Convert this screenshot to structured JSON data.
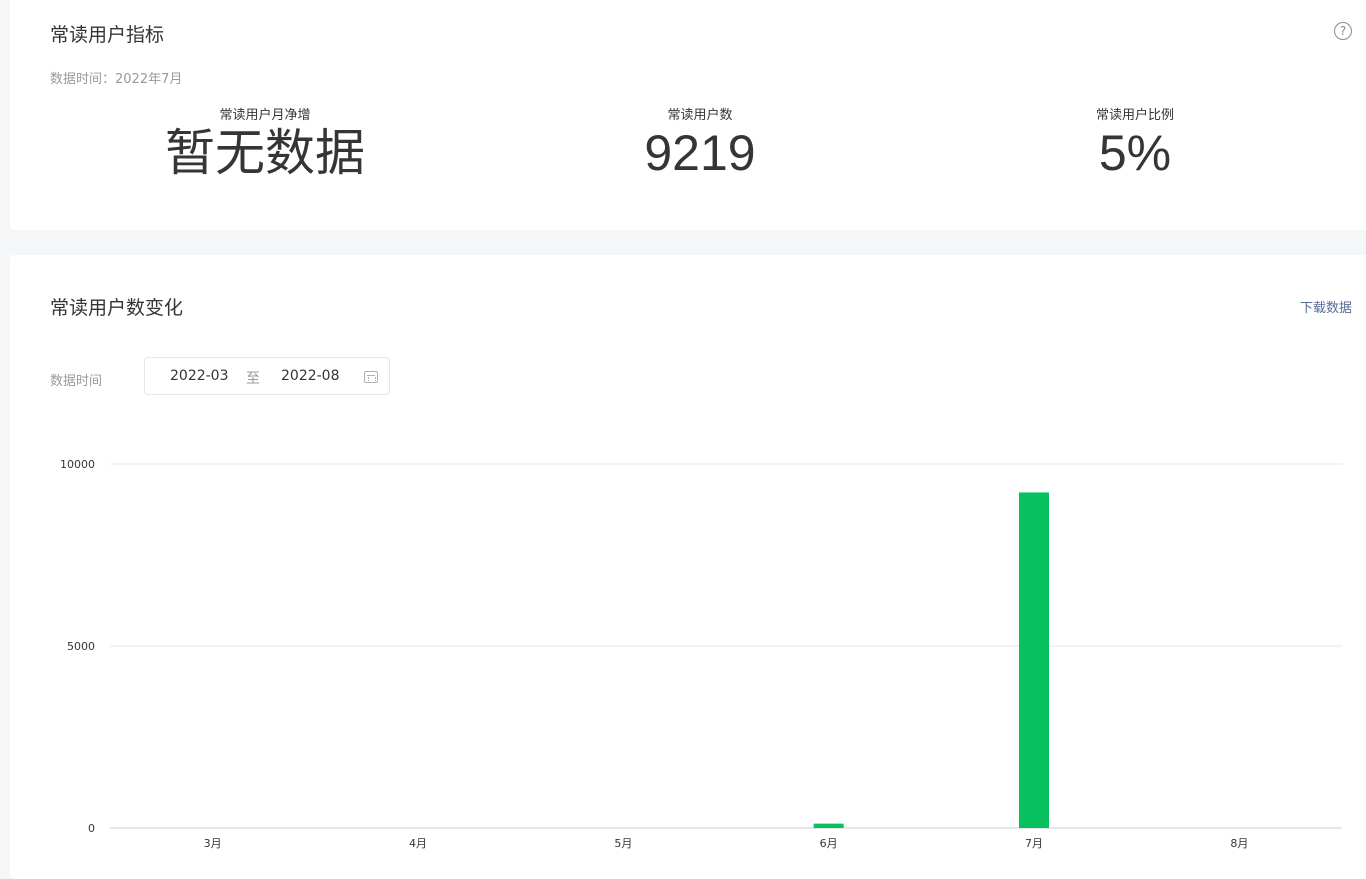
{
  "metrics_card": {
    "title": "常读用户指标",
    "help_icon": "question-circle-icon",
    "data_time": "数据时间：2022年7月",
    "metrics": [
      {
        "label": "常读用户月净增",
        "value": "暂无数据"
      },
      {
        "label": "常读用户数",
        "value": "9219"
      },
      {
        "label": "常读用户比例",
        "value": "5%"
      }
    ]
  },
  "trend_card": {
    "title": "常读用户数变化",
    "download_label": "下载数据",
    "filter_label": "数据时间",
    "date_range": {
      "start": "2022-03",
      "separator": "至",
      "end": "2022-08",
      "icon": "calendar-icon"
    }
  },
  "colors": {
    "bar": "#07c160",
    "link": "#576b95",
    "grid": "#e7e7e7",
    "axis": "#c9ccd6"
  },
  "chart_data": {
    "type": "bar",
    "categories": [
      "3月",
      "4月",
      "5月",
      "6月",
      "7月",
      "8月"
    ],
    "values": [
      0,
      0,
      0,
      120,
      9219,
      0
    ],
    "yticks": [
      0,
      5000,
      10000
    ],
    "ylim": [
      0,
      10000
    ],
    "grid": true,
    "legend": false
  }
}
